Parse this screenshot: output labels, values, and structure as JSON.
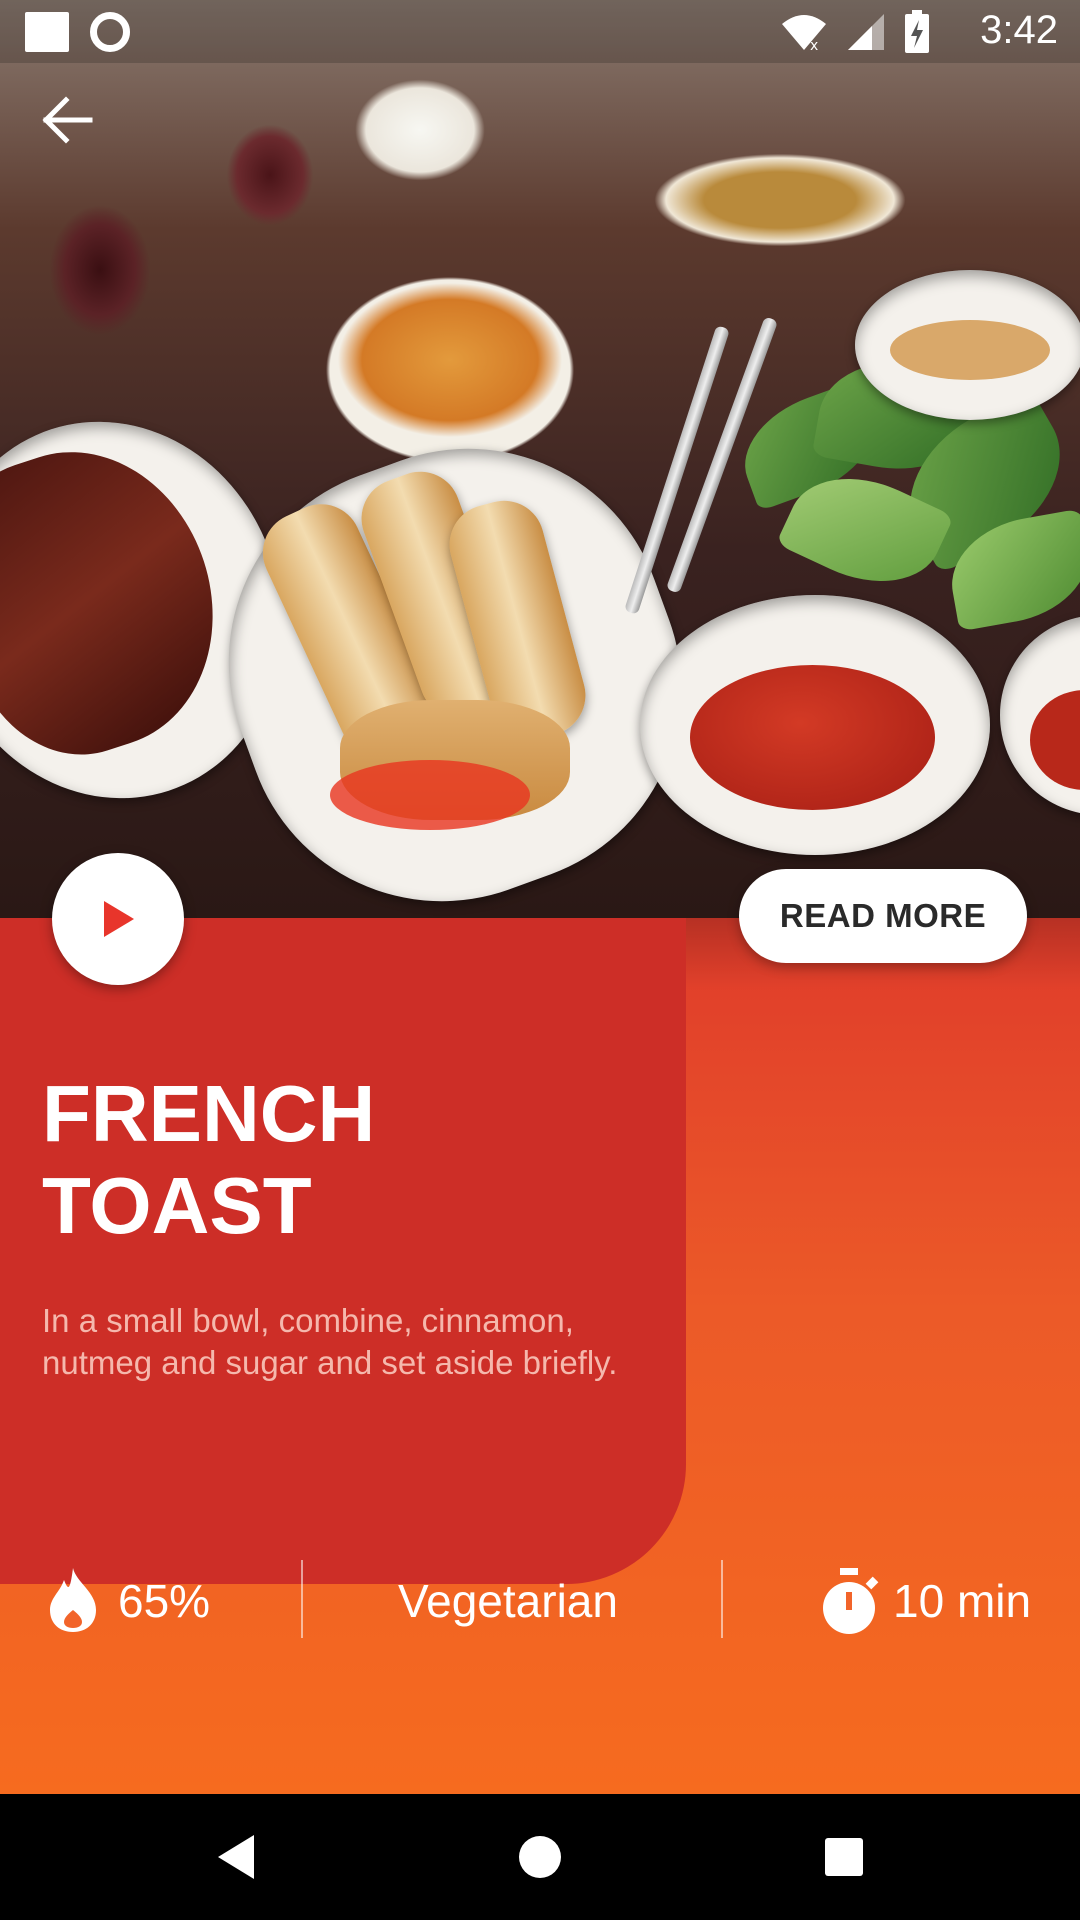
{
  "status_bar": {
    "time": "3:42",
    "icons": [
      "notification-square-icon",
      "notification-ring-icon",
      "wifi-icon",
      "signal-icon",
      "battery-charging-icon"
    ]
  },
  "hero": {
    "back_icon": "arrow-back-icon",
    "play_icon": "play-icon",
    "read_more_label": "READ MORE"
  },
  "recipe": {
    "title_line1": "FRENCH",
    "title_line2": "TOAST",
    "description": "In a small bowl, combine, cinnamon, nutmeg and sugar and set aside briefly."
  },
  "stats": {
    "calories": {
      "icon": "flame-icon",
      "value": "65%"
    },
    "category": {
      "value": "Vegetarian"
    },
    "time": {
      "icon": "timer-icon",
      "value": "10 min"
    }
  },
  "nav_bar": {
    "icons": [
      "back-triangle-icon",
      "home-circle-icon",
      "recents-square-icon"
    ]
  },
  "colors": {
    "panel": "#cd2e27",
    "card_top": "#df3b2b",
    "card_bottom": "#f66b1f",
    "accent_red": "#e8352b"
  }
}
